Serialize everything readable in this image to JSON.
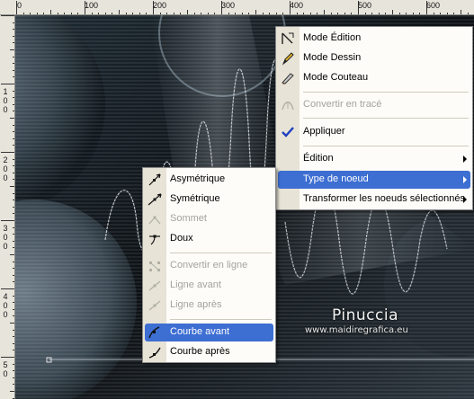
{
  "ruler": {
    "top_labels": [
      "0",
      "100",
      "200",
      "300",
      "400",
      "500",
      "600"
    ],
    "left_labels": [
      "1",
      "2",
      "3",
      "4",
      "5"
    ]
  },
  "watermark": {
    "name": "Pinuccia",
    "url": "www.maidiregrafica.eu"
  },
  "main_menu": {
    "items": [
      {
        "label": "Mode Édition",
        "icon": "edit-mode-icon"
      },
      {
        "label": "Mode Dessin",
        "icon": "pencil-icon"
      },
      {
        "label": "Mode Couteau",
        "icon": "knife-icon"
      },
      {
        "label": "Convertir en tracé",
        "icon": "convert-path-icon"
      },
      {
        "label": "Appliquer",
        "icon": "checkmark-icon"
      },
      {
        "label": "Édition"
      },
      {
        "label": "Type de noeud"
      },
      {
        "label": "Transformer les noeuds sélectionnés"
      }
    ]
  },
  "submenu": {
    "items": [
      {
        "label": "Asymétrique",
        "icon": "asymmetric-node-icon"
      },
      {
        "label": "Symétrique",
        "icon": "symmetric-node-icon"
      },
      {
        "label": "Sommet",
        "icon": "cusp-node-icon"
      },
      {
        "label": "Doux",
        "icon": "smooth-node-icon"
      },
      {
        "label": "Convertir en ligne",
        "icon": "convert-line-icon"
      },
      {
        "label": "Ligne avant",
        "icon": "line-before-icon"
      },
      {
        "label": "Ligne après",
        "icon": "line-after-icon"
      },
      {
        "label": "Courbe avant",
        "icon": "curve-before-icon"
      },
      {
        "label": "Courbe après",
        "icon": "curve-after-icon"
      }
    ]
  },
  "colors": {
    "highlight": "#3d6ed2",
    "menu_background": "#fdfcf8",
    "gutter": "#e7e3d6",
    "disabled_text": "#a3a39e"
  }
}
